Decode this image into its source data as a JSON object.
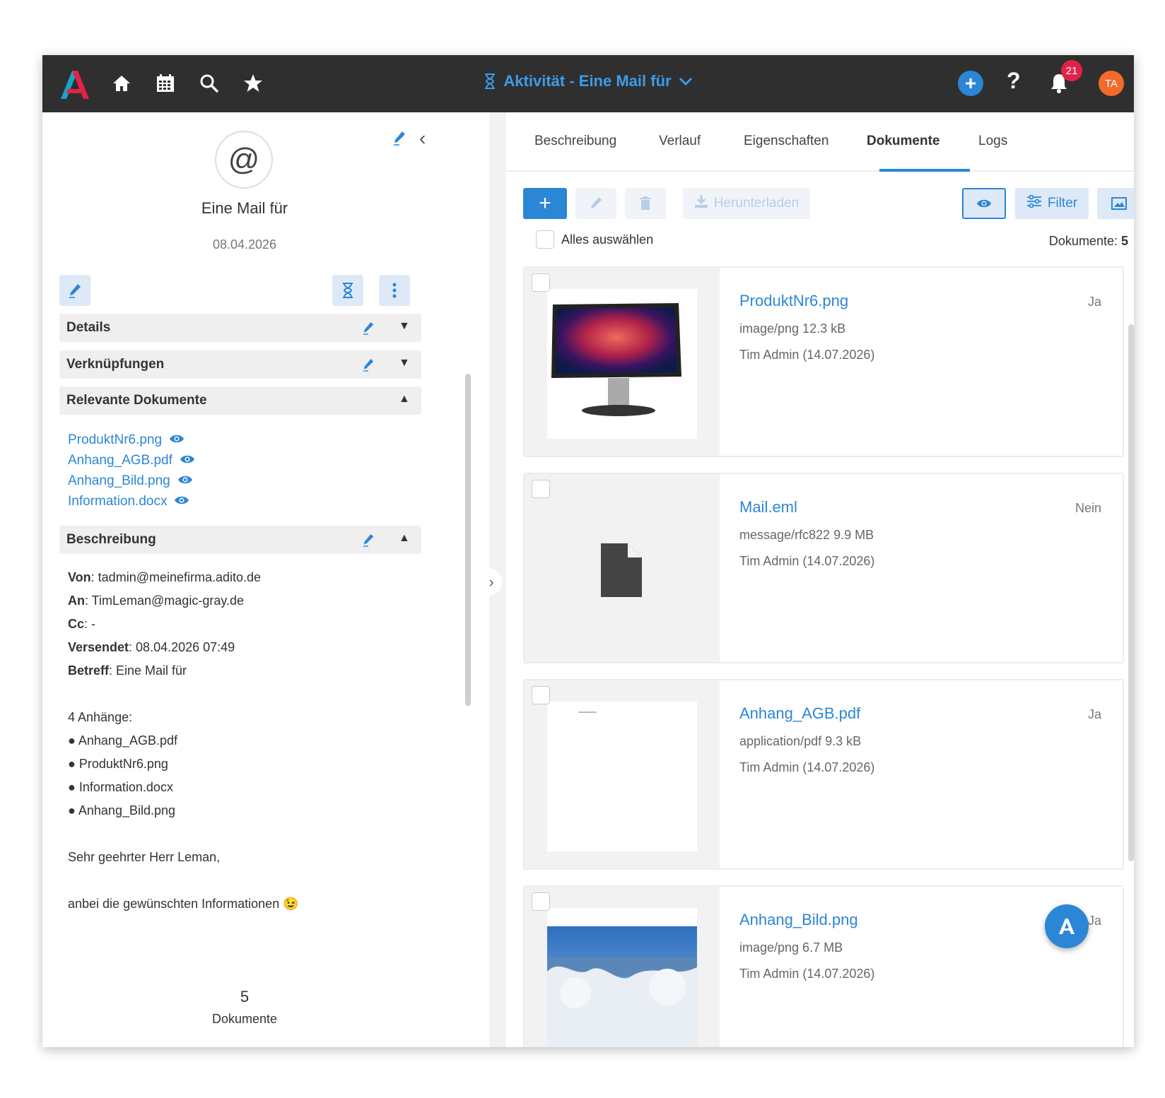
{
  "header": {
    "title": "Aktivität - Eine Mail für",
    "notifications_count": "21",
    "avatar_initials": "TA",
    "help_label": "?"
  },
  "entity": {
    "title": "Eine Mail für",
    "date": "08.04.2026",
    "icon_glyph": "@"
  },
  "sections": {
    "details": "Details",
    "links": "Verknüpfungen",
    "relevant_docs": "Relevante Dokumente",
    "description": "Beschreibung"
  },
  "relevant_docs": [
    "ProduktNr6.png",
    "Anhang_AGB.pdf",
    "Anhang_Bild.png",
    "Information.docx"
  ],
  "description": {
    "from_label": "Von",
    "from": ": tadmin@meinefirma.adito.de",
    "to_label": "An",
    "to": ": TimLeman@magic-gray.de",
    "cc_label": "Cc",
    "cc": ": -",
    "sent_label": "Versendet",
    "sent": ": 08.04.2026 07:49",
    "subject_label": "Betreff",
    "subject": ": Eine Mail für",
    "attachments_title": "4 Anhänge:",
    "attachments": [
      "Anhang_AGB.pdf",
      "ProduktNr6.png",
      "Information.docx",
      "Anhang_Bild.png"
    ],
    "greeting": "Sehr geehrter Herr Leman,",
    "body": "anbei die gewünschten Informationen 😉"
  },
  "summary": {
    "count": "5",
    "label": "Dokumente"
  },
  "tabs": [
    "Beschreibung",
    "Verlauf",
    "Eigenschaften",
    "Dokumente",
    "Logs"
  ],
  "toolbar": {
    "add": "+",
    "download": "Herunterladen",
    "filter": "Filter"
  },
  "select_all": "Alles auswählen",
  "doc_total_label": "Dokumente: ",
  "doc_total_value": "5",
  "documents": [
    {
      "name": "ProduktNr6.png",
      "meta": "image/png 12.3 kB",
      "author": "Tim Admin (14.07.2026)",
      "flag": "Ja"
    },
    {
      "name": "Mail.eml",
      "meta": "message/rfc822 9.9 MB",
      "author": "Tim Admin (14.07.2026)",
      "flag": "Nein"
    },
    {
      "name": "Anhang_AGB.pdf",
      "meta": "application/pdf 9.3 kB",
      "author": "Tim Admin (14.07.2026)",
      "flag": "Ja"
    },
    {
      "name": "Anhang_Bild.png",
      "meta": "image/png 6.7 MB",
      "author": "Tim Admin (14.07.2026)",
      "flag": "Ja"
    }
  ],
  "colors": {
    "accent": "#2c86d6",
    "topbar": "#2f2f2f",
    "badge": "#e3224a",
    "avatar": "#f26a2c"
  }
}
